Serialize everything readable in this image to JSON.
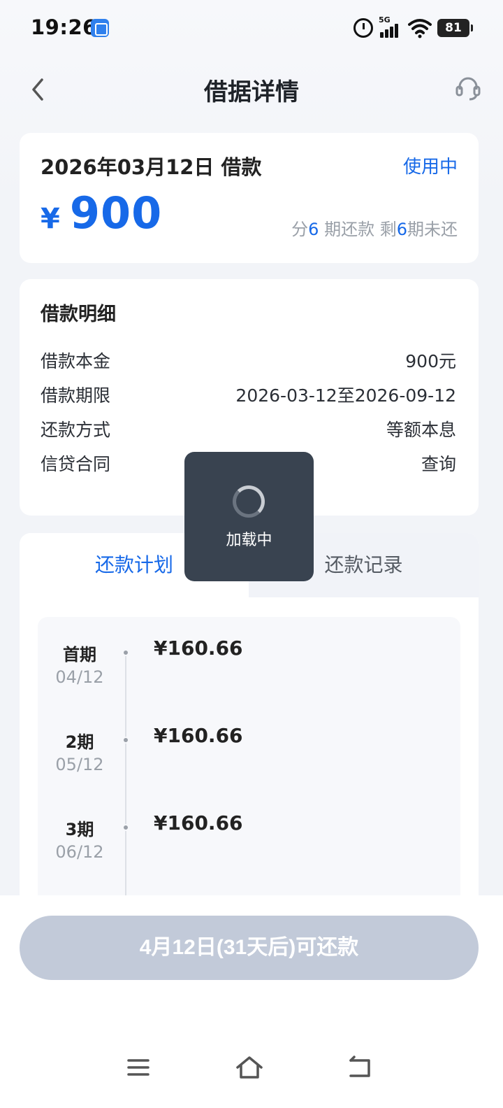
{
  "status_bar": {
    "time": "19:26",
    "network": "5G",
    "battery": "81"
  },
  "header": {
    "title": "借据详情"
  },
  "loan_summary": {
    "date_label": "2026年03月12日 借款",
    "status": "使用中",
    "currency": "¥",
    "amount": "900",
    "terms_prefix": "分",
    "total_periods": "6",
    "terms_mid": " 期还款 剩",
    "remaining_periods": "6",
    "terms_suffix": "期未还"
  },
  "loan_detail": {
    "title": "借款明细",
    "rows": [
      {
        "label": "借款本金",
        "value": "900元"
      },
      {
        "label": "借款期限",
        "value": "2026-03-12至2026-09-12"
      },
      {
        "label": "还款方式",
        "value": "等额本息"
      },
      {
        "label": "信贷合同",
        "value": "查询"
      }
    ]
  },
  "tabs": {
    "plan": "还款计划",
    "record": "还款记录"
  },
  "schedule": [
    {
      "period": "首期",
      "date": "04/12",
      "amount": "¥160.66"
    },
    {
      "period": "2期",
      "date": "05/12",
      "amount": "¥160.66"
    },
    {
      "period": "3期",
      "date": "06/12",
      "amount": "¥160.66"
    }
  ],
  "repay_button": "4月12日(31天后)可还款",
  "loading": {
    "text": "加载中"
  },
  "colors": {
    "accent": "#1769e8",
    "button_disabled": "#c2cad9",
    "toast_bg": "#394350"
  }
}
